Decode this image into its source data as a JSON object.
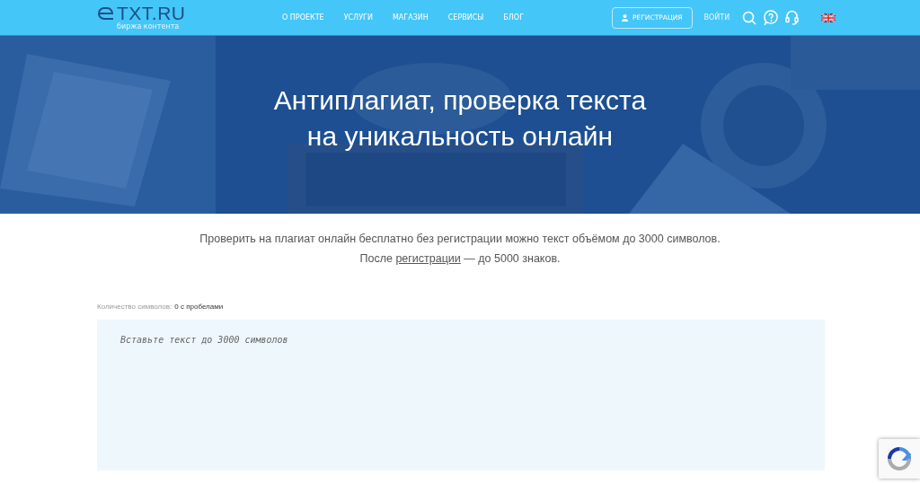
{
  "header": {
    "logo": "TXT.RU",
    "tagline": "биржа контента",
    "nav": [
      "О ПРОЕКТЕ",
      "УСЛУГИ",
      "МАГАЗИН",
      "СЕРВИСЫ",
      "БЛОГ"
    ],
    "register": "РЕГИСТРАЦИЯ",
    "login": "ВОЙТИ"
  },
  "hero": {
    "kind": "picture",
    "title": "Антиплагиат, проверка текста\nна уникальность онлайн"
  },
  "intro": {
    "line_1": "Проверить на плагиат онлайн бесплатно без регистрации можно текст объёмом до 3000 символов.",
    "line_2_before": "После",
    "line_2_link": "регистрации",
    "line_2_after": "— до 5000 знаков."
  },
  "counter": {
    "label": "Количество символов:",
    "value": "0 с пробелами"
  },
  "editor": {
    "placeholder": "Вставьте текст до 3000 символов"
  }
}
